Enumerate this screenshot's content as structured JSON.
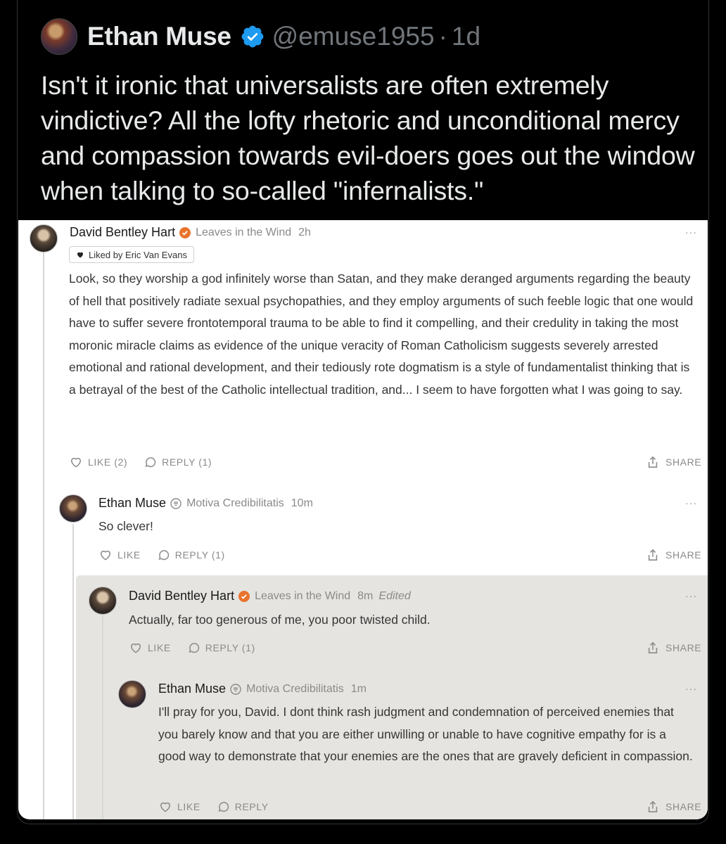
{
  "tweet": {
    "author_name": "Ethan Muse",
    "handle": "@emuse1955",
    "separator": "·",
    "time": "1d",
    "text": "Isn't it ironic that universalists are often extremely vindictive? All the lofty rhetoric and unconditional mercy and compassion towards evil-doers goes out the window when talking to so-called \"infernalists.\""
  },
  "comments": [
    {
      "author": "David Bentley Hart",
      "publication": "Leaves in the Wind",
      "time": "2h",
      "edited": "",
      "more": "···",
      "liked_by": "Liked by Eric Van Evans",
      "body": "Look, so they worship a god infinitely worse than Satan, and they make deranged arguments regarding the beauty of hell that positively radiate sexual psychopathies, and they employ arguments of such feeble logic that one would have to suffer severe frontotemporal trauma to be able to find it compelling, and their credulity in taking the most moronic miracle claims as evidence of the unique veracity of Roman Catholicism suggests severely arrested emotional and rational development, and their tediously rote dogmatism is a style of fundamentalist thinking that is a betrayal of the best of the Catholic intellectual tradition, and... I seem to have forgotten what I was going to say.",
      "like_label": "LIKE (2)",
      "reply_label": "REPLY (1)",
      "share_label": "SHARE"
    },
    {
      "author": "Ethan Muse",
      "publication": "Motiva Credibilitatis",
      "time": "10m",
      "more": "···",
      "body": "So clever!",
      "like_label": "LIKE",
      "reply_label": "REPLY (1)",
      "share_label": "SHARE"
    },
    {
      "author": "David Bentley Hart",
      "publication": "Leaves in the Wind",
      "time": "8m",
      "edited": "Edited",
      "more": "···",
      "body": "Actually, far too generous of me, you poor twisted child.",
      "like_label": "LIKE",
      "reply_label": "REPLY (1)",
      "share_label": "SHARE"
    },
    {
      "author": "Ethan Muse",
      "publication": "Motiva Credibilitatis",
      "time": "1m",
      "more": "···",
      "body": "I'll pray for you, David. I dont think rash judgment and condemnation of perceived enemies that you barely know and that you are either unwilling or unable to have cognitive empathy for is a good way to demonstrate that your enemies are the ones that are gravely deficient in compassion.",
      "like_label": "LIKE",
      "reply_label": "REPLY",
      "share_label": "SHARE"
    }
  ],
  "colors": {
    "verified_blue": "#1d9bf0",
    "substack_orange": "#e8732c",
    "reply_background": "#e5e4e0"
  },
  "icons": [
    "verified-badge-icon",
    "heart-icon",
    "speech-bubble-icon",
    "share-icon",
    "more-icon"
  ]
}
